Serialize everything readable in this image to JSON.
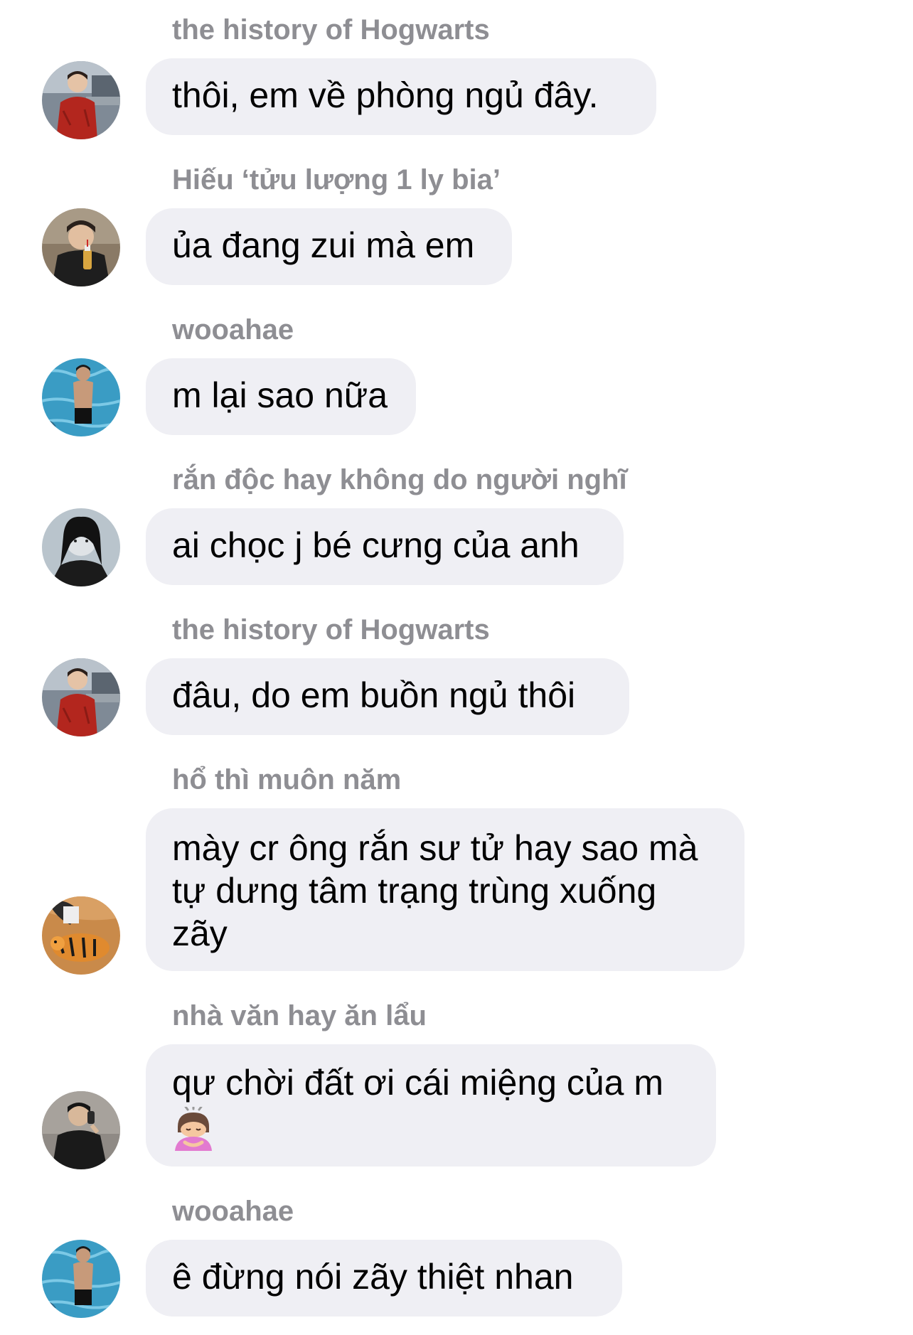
{
  "messages": [
    {
      "sender": "the history of Hogwarts",
      "text": "thôi, em về phòng ngủ đây.",
      "avatar": "avatar-red-sweater"
    },
    {
      "sender": "Hiếu ‘tửu lượng 1 ly bia’",
      "text": "ủa đang zui mà em",
      "avatar": "avatar-drinking"
    },
    {
      "sender": "wooahae",
      "text": "m lại sao nữa",
      "avatar": "avatar-pool"
    },
    {
      "sender": "rắn độc hay không do người nghĩ",
      "text": "ai chọc j bé cưng của anh",
      "avatar": "avatar-dark-hair"
    },
    {
      "sender": "the history of Hogwarts",
      "text": "đâu, do em buồn ngủ thôi",
      "avatar": "avatar-red-sweater"
    },
    {
      "sender": "hổ thì muôn năm",
      "text": "mày cr ông rắn sư tử hay sao mà\ntự dưng tâm trạng trùng xuống\nzãy",
      "avatar": "avatar-tiger"
    },
    {
      "sender": "nhà văn hay ăn lẩu",
      "text": "qư chời đất ơi cái miệng của m",
      "emoji": "bowing-person-emoji",
      "avatar": "avatar-black-shirt"
    },
    {
      "sender": "wooahae",
      "text": "ê đừng nói zãy thiệt nhan",
      "avatar": "avatar-pool"
    }
  ],
  "colors": {
    "bubble": "#efeff4",
    "sender_name": "#8e8e93",
    "message_text": "#000000"
  }
}
